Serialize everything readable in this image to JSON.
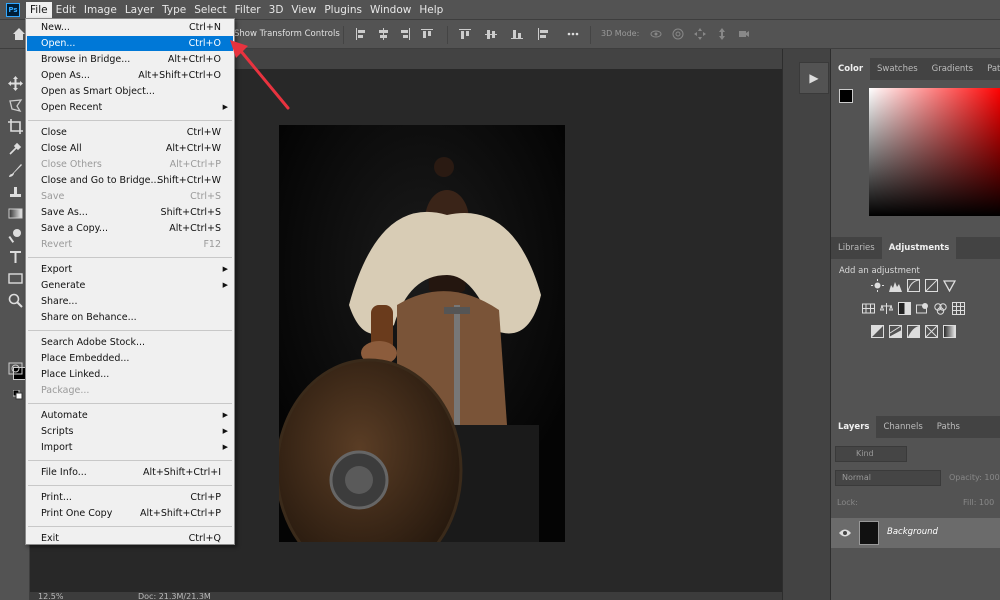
{
  "app": {
    "logo": "Ps"
  },
  "menubar": {
    "items": [
      "File",
      "Edit",
      "Image",
      "Layer",
      "Type",
      "Select",
      "Filter",
      "3D",
      "View",
      "Plugins",
      "Window",
      "Help"
    ],
    "active_index": 0
  },
  "options": {
    "show_transform": "Show Transform Controls",
    "mode_3d": "3D Mode:"
  },
  "status": {
    "zoom": "12.5%",
    "doc": "Doc: 21.3M/21.3M"
  },
  "panels": {
    "top_tabs": [
      "Color",
      "Swatches",
      "Gradients",
      "Patte"
    ],
    "mid_tabs": [
      "Libraries",
      "Adjustments"
    ],
    "add_adjustment": "Add an adjustment",
    "layer_tabs": [
      "Layers",
      "Channels",
      "Paths"
    ],
    "kind": "Kind",
    "blend": "Normal",
    "opacity": "Opacity: 100",
    "lock": "Lock:",
    "fill": "Fill: 100",
    "layer_name": "Background"
  },
  "file_menu": [
    {
      "label": "New...",
      "shortcut": "Ctrl+N"
    },
    {
      "label": "Open...",
      "shortcut": "Ctrl+O",
      "highlight": true
    },
    {
      "label": "Browse in Bridge...",
      "shortcut": "Alt+Ctrl+O"
    },
    {
      "label": "Open As...",
      "shortcut": "Alt+Shift+Ctrl+O"
    },
    {
      "label": "Open as Smart Object...",
      "shortcut": ""
    },
    {
      "label": "Open Recent",
      "shortcut": "",
      "submenu": true
    },
    {
      "sep": true
    },
    {
      "label": "Close",
      "shortcut": "Ctrl+W"
    },
    {
      "label": "Close All",
      "shortcut": "Alt+Ctrl+W"
    },
    {
      "label": "Close Others",
      "shortcut": "Alt+Ctrl+P",
      "disabled": true
    },
    {
      "label": "Close and Go to Bridge...",
      "shortcut": "Shift+Ctrl+W"
    },
    {
      "label": "Save",
      "shortcut": "Ctrl+S",
      "disabled": true
    },
    {
      "label": "Save As...",
      "shortcut": "Shift+Ctrl+S"
    },
    {
      "label": "Save a Copy...",
      "shortcut": "Alt+Ctrl+S"
    },
    {
      "label": "Revert",
      "shortcut": "F12",
      "disabled": true
    },
    {
      "sep": true
    },
    {
      "label": "Export",
      "shortcut": "",
      "submenu": true
    },
    {
      "label": "Generate",
      "shortcut": "",
      "submenu": true
    },
    {
      "label": "Share...",
      "shortcut": ""
    },
    {
      "label": "Share on Behance...",
      "shortcut": ""
    },
    {
      "sep": true
    },
    {
      "label": "Search Adobe Stock...",
      "shortcut": ""
    },
    {
      "label": "Place Embedded...",
      "shortcut": ""
    },
    {
      "label": "Place Linked...",
      "shortcut": ""
    },
    {
      "label": "Package...",
      "shortcut": "",
      "disabled": true
    },
    {
      "sep": true
    },
    {
      "label": "Automate",
      "shortcut": "",
      "submenu": true
    },
    {
      "label": "Scripts",
      "shortcut": "",
      "submenu": true
    },
    {
      "label": "Import",
      "shortcut": "",
      "submenu": true
    },
    {
      "sep": true
    },
    {
      "label": "File Info...",
      "shortcut": "Alt+Shift+Ctrl+I"
    },
    {
      "sep": true
    },
    {
      "label": "Print...",
      "shortcut": "Ctrl+P"
    },
    {
      "label": "Print One Copy",
      "shortcut": "Alt+Shift+Ctrl+P"
    },
    {
      "sep": true
    },
    {
      "label": "Exit",
      "shortcut": "Ctrl+Q"
    }
  ]
}
